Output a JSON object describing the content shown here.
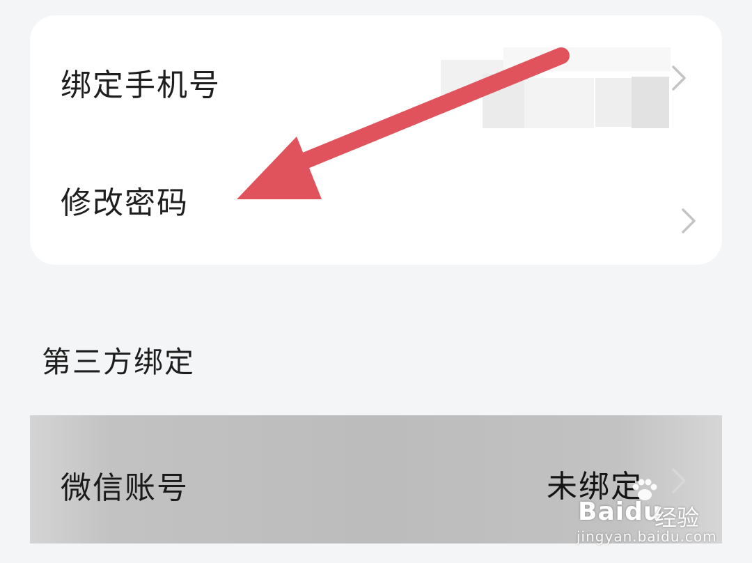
{
  "account_card": {
    "bind_phone_label": "绑定手机号",
    "change_password_label": "修改密码"
  },
  "third_party": {
    "section_title": "第三方绑定",
    "wechat_label": "微信账号",
    "wechat_status": "未绑定"
  },
  "annotation": {
    "arrow_color": "#e0525c",
    "arrow_icon": "pointing-arrow-icon"
  },
  "watermark": {
    "brand": "Baidu",
    "brand_suffix": "经验",
    "url": "jingyan.baidu.com"
  },
  "colors": {
    "background": "#f4f5f7",
    "card": "#ffffff",
    "text": "#1e1e1e",
    "chevron": "#c4c4c4"
  }
}
